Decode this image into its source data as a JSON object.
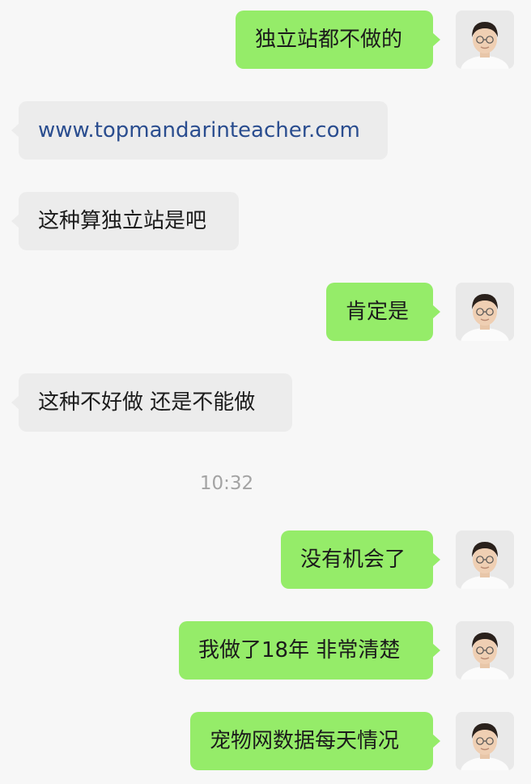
{
  "colors": {
    "background": "#f7f7f7",
    "outgoing_bubble": "#95ec69",
    "incoming_bubble": "#ececec",
    "link_text": "#2a4d8f",
    "timestamp_text": "#a3a3a3"
  },
  "messages": [
    {
      "direction": "outgoing",
      "text": "独立站都不做的",
      "avatar": "user-avatar"
    },
    {
      "direction": "incoming",
      "text": "www.topmandarinteacher.com",
      "is_link": true
    },
    {
      "direction": "incoming",
      "text": "这种算独立站是吧"
    },
    {
      "direction": "outgoing",
      "text": "肯定是",
      "avatar": "user-avatar"
    },
    {
      "direction": "incoming",
      "text": "这种不好做 还是不能做"
    },
    {
      "direction": "outgoing",
      "text": "没有机会了",
      "avatar": "user-avatar"
    },
    {
      "direction": "outgoing",
      "text": "我做了18年 非常清楚",
      "avatar": "user-avatar"
    },
    {
      "direction": "outgoing",
      "text": "宠物网数据每天情况",
      "avatar": "user-avatar"
    }
  ],
  "timestamp": "10:32"
}
